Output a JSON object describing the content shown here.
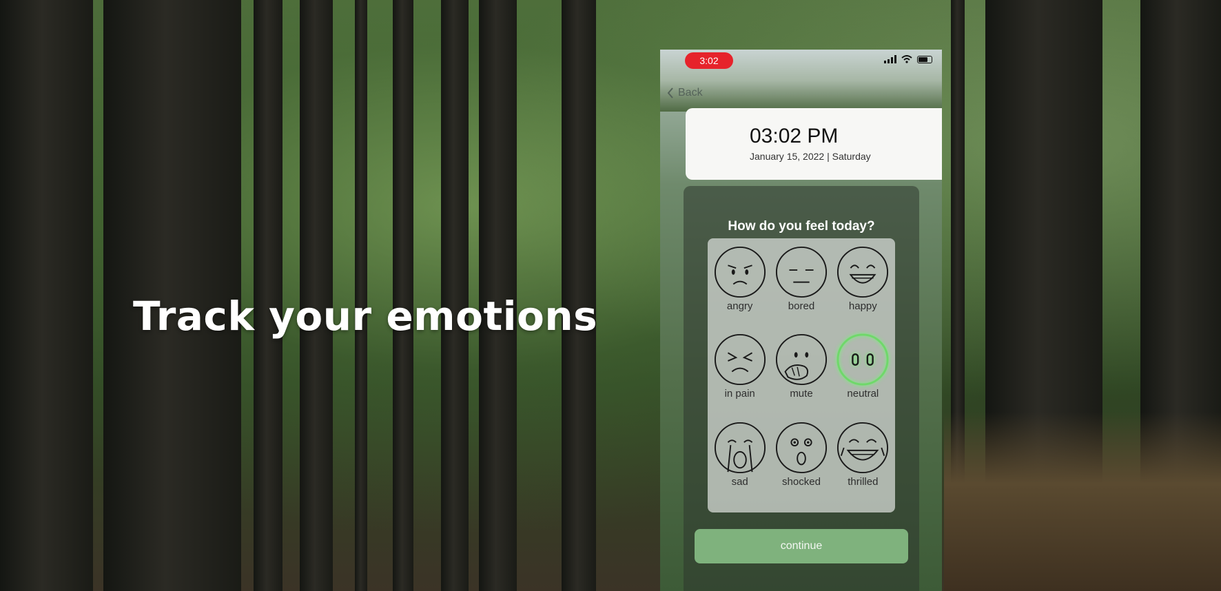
{
  "hero": {
    "headline": "Track your emotions"
  },
  "status_bar": {
    "time": "3:02"
  },
  "nav": {
    "back_label": "Back"
  },
  "time_card": {
    "clock": "03:02 PM",
    "date": "January 15, 2022 | Saturday"
  },
  "mood_picker": {
    "question": "How do you feel today?",
    "selected": "neutral",
    "accent_color": "#6fd86a",
    "options": [
      {
        "label": "angry",
        "icon": "angry-face-icon"
      },
      {
        "label": "bored",
        "icon": "bored-face-icon"
      },
      {
        "label": "happy",
        "icon": "happy-face-icon"
      },
      {
        "label": "in pain",
        "icon": "in-pain-face-icon"
      },
      {
        "label": "mute",
        "icon": "mute-face-icon"
      },
      {
        "label": "neutral",
        "icon": "neutral-face-icon"
      },
      {
        "label": "sad",
        "icon": "sad-face-icon"
      },
      {
        "label": "shocked",
        "icon": "shocked-face-icon"
      },
      {
        "label": "thrilled",
        "icon": "thrilled-face-icon"
      }
    ]
  },
  "actions": {
    "continue_label": "continue",
    "continue_color": "#7fb27d"
  }
}
